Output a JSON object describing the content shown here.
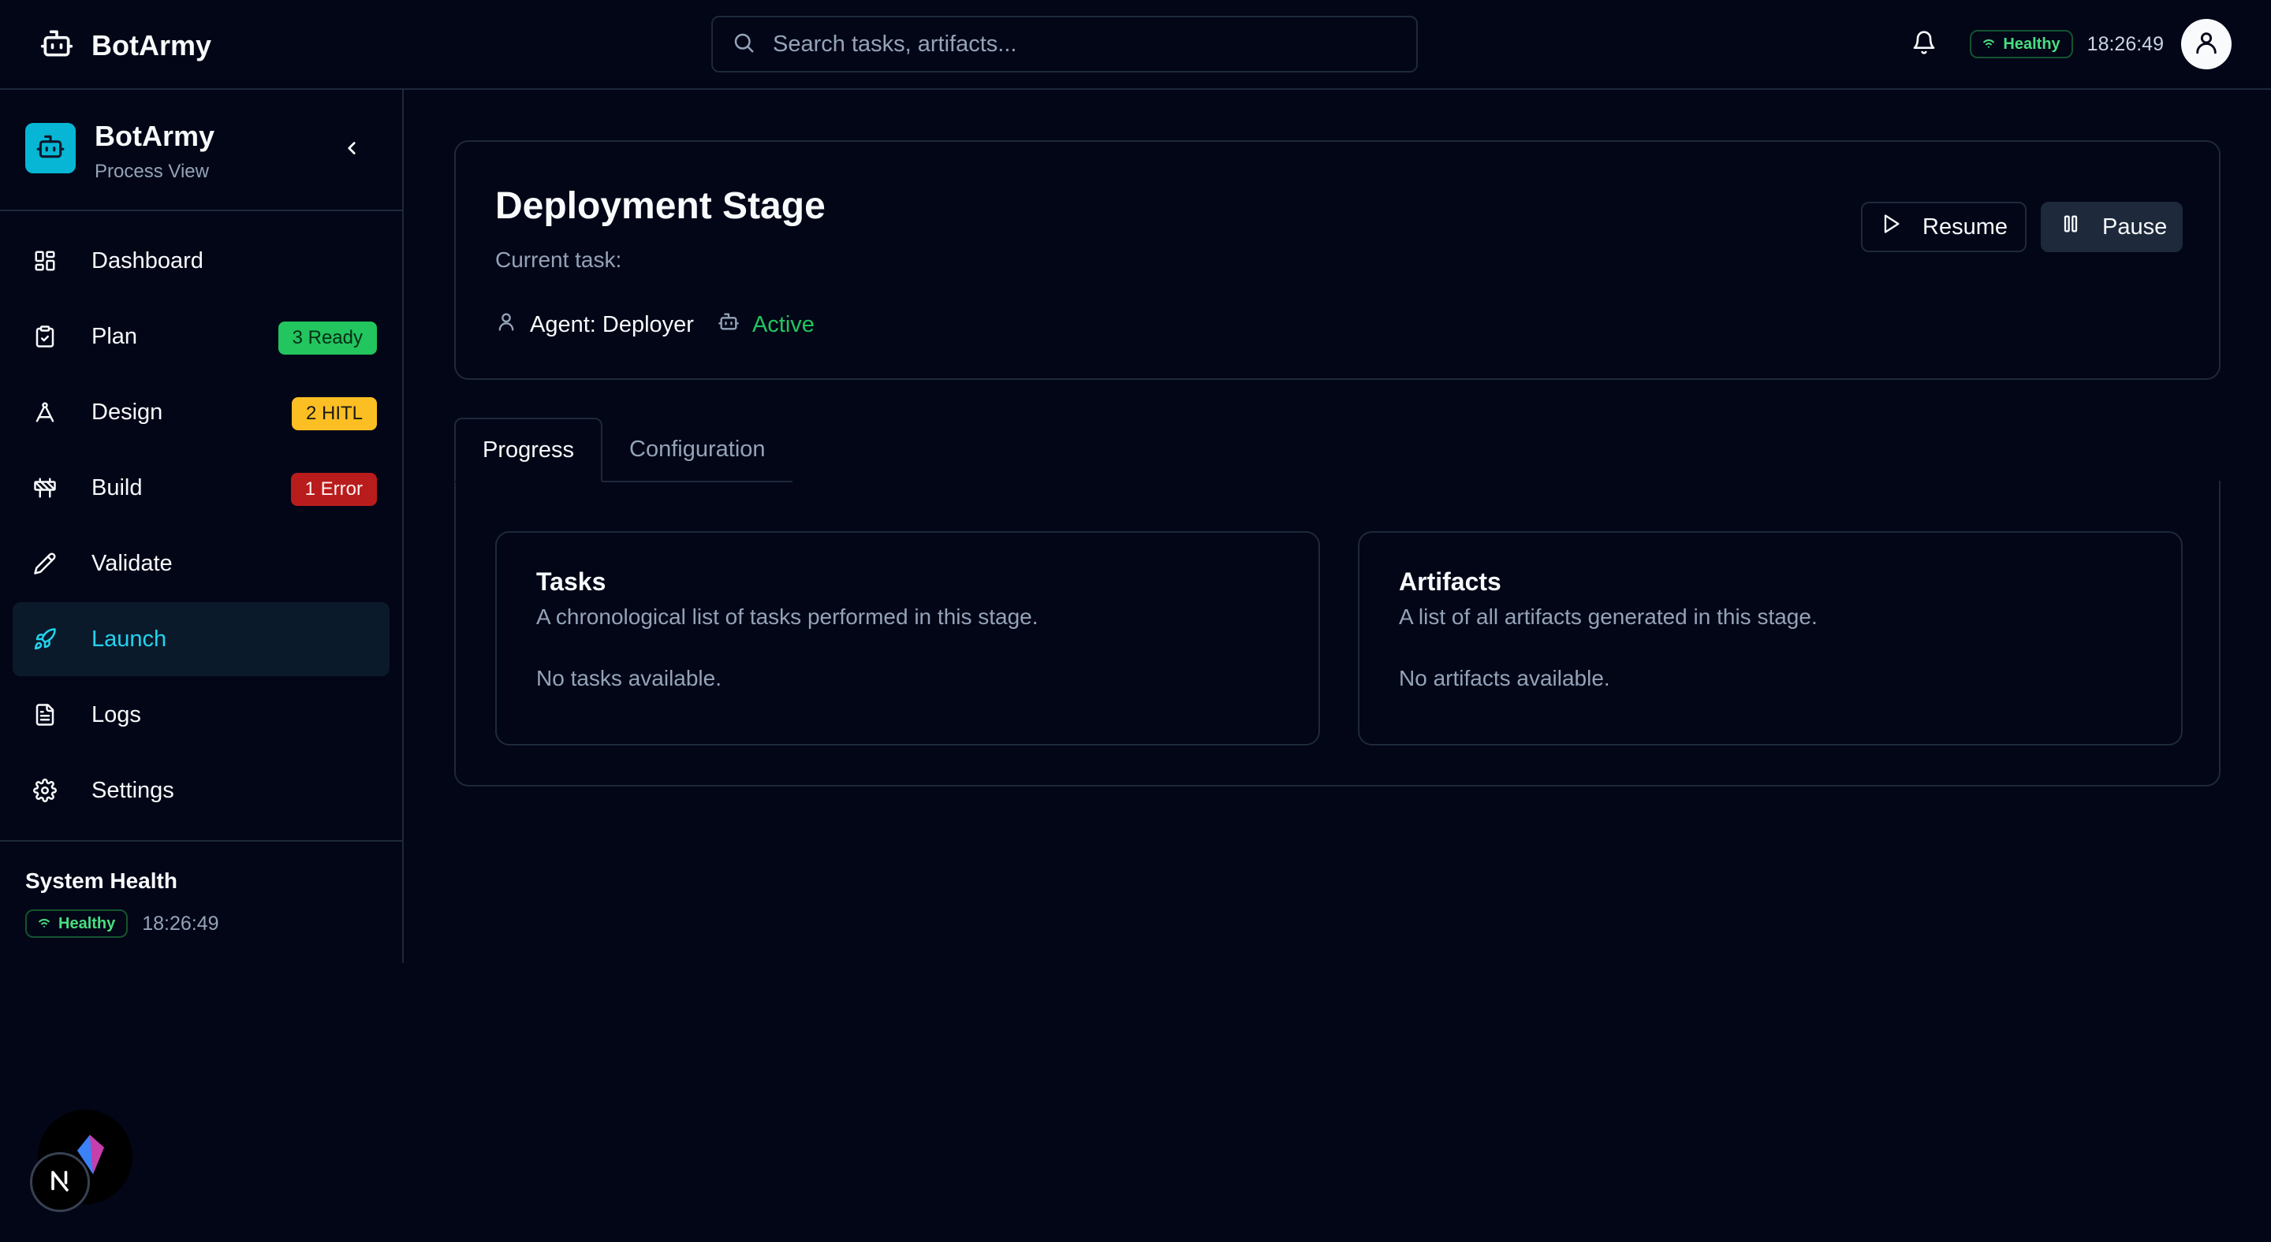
{
  "app": {
    "name": "BotArmy"
  },
  "search": {
    "placeholder": "Search tasks, artifacts..."
  },
  "topbar": {
    "health": "Healthy",
    "time": "18:26:49"
  },
  "sidebar": {
    "title": "BotArmy",
    "subtitle": "Process View",
    "items": [
      {
        "label": "Dashboard",
        "icon": "dashboard-icon"
      },
      {
        "label": "Plan",
        "icon": "clipboard-icon",
        "badge": "3 Ready",
        "badge_color": "#22c55e"
      },
      {
        "label": "Design",
        "icon": "compass-icon",
        "badge": "2 HITL",
        "badge_color": "#fbbf24"
      },
      {
        "label": "Build",
        "icon": "construction-icon",
        "badge": "1 Error",
        "badge_color": "#b91c1c"
      },
      {
        "label": "Validate",
        "icon": "pencil-icon"
      },
      {
        "label": "Launch",
        "icon": "rocket-icon",
        "active": true
      },
      {
        "label": "Logs",
        "icon": "file-text-icon"
      },
      {
        "label": "Settings",
        "icon": "gear-icon"
      }
    ],
    "footer": {
      "title": "System Health",
      "health": "Healthy",
      "time": "18:26:49"
    }
  },
  "stage": {
    "title": "Deployment Stage",
    "current_task": "Current task:",
    "agent": "Agent: Deployer",
    "status": "Active",
    "resume_label": "Resume",
    "pause_label": "Pause"
  },
  "tabs": [
    {
      "label": "Progress",
      "active": true
    },
    {
      "label": "Configuration"
    }
  ],
  "progress": {
    "tasks": {
      "title": "Tasks",
      "description": "A chronological list of tasks performed in this stage.",
      "empty": "No tasks available."
    },
    "artifacts": {
      "title": "Artifacts",
      "description": "A list of all artifacts generated in this stage.",
      "empty": "No artifacts available."
    }
  },
  "colors": {
    "accent": "#22d3ee",
    "background": "#020617",
    "border": "#1e293b",
    "healthy": "#4ade80"
  }
}
